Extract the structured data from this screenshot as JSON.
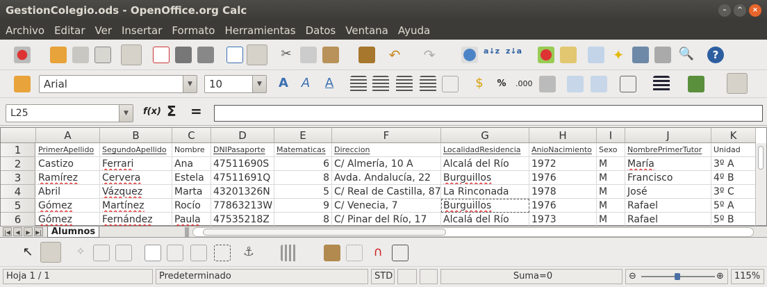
{
  "window": {
    "title": "GestionColegio.ods - OpenOffice.org Calc"
  },
  "menu": [
    "Archivo",
    "Editar",
    "Ver",
    "Insertar",
    "Formato",
    "Herramientas",
    "Datos",
    "Ventana",
    "Ayuda"
  ],
  "format_bar": {
    "font_name": "Arial",
    "font_size": "10"
  },
  "formula_bar": {
    "cell_ref": "L25",
    "fx": "f(x)",
    "sum": "Σ",
    "equals": "=",
    "content": ""
  },
  "columns": [
    "A",
    "B",
    "C",
    "D",
    "E",
    "F",
    "G",
    "H",
    "I",
    "J",
    "K"
  ],
  "rows": [
    "1",
    "2",
    "3",
    "4",
    "5",
    "6"
  ],
  "headers": [
    "PrimerApellido",
    "SegundoApellido",
    "Nombre",
    "DNIPasaporte",
    "Matematicas",
    "Direccion",
    "LocalidadResidencia",
    "AnioNacimiento",
    "Sexo",
    "NombrePrimerTutor",
    "Unidad"
  ],
  "data": [
    {
      "A": "Castizo",
      "B": "Ferrari",
      "C": "Ana",
      "D": "47511690S",
      "E": "6",
      "F": "C/ Almería, 10 A",
      "G": "Alcalá del Río",
      "H": "1972",
      "I": "M",
      "J": "María",
      "K": "3º A"
    },
    {
      "A": "Ramírez",
      "B": "Cervera",
      "C": "Estela",
      "D": "47511691Q",
      "E": "8",
      "F": "Avda. Andalucía, 22",
      "G": "Burguillos",
      "H": "1976",
      "I": "M",
      "J": "Francisco",
      "K": "4º B"
    },
    {
      "A": "Abril",
      "B": "Vázquez",
      "C": "Marta",
      "D": "43201326N",
      "E": "5",
      "F": "C/ Real de Castilla, 87",
      "G": "La Rinconada",
      "H": "1978",
      "I": "M",
      "J": "José",
      "K": "3º C"
    },
    {
      "A": "Gómez",
      "B": "Martínez",
      "C": "Rocío",
      "D": "77863213W",
      "E": "9",
      "F": "C/ Venecia, 7",
      "G": "Burguillos",
      "H": "1976",
      "I": "M",
      "J": "Rafael",
      "K": "5º A"
    },
    {
      "A": "Gómez",
      "B": "Fernández",
      "C": "Paula",
      "D": "47535218Z",
      "E": "8",
      "F": "C/ Pinar del Río, 17",
      "G": "Alcalá del Río",
      "H": "1973",
      "I": "M",
      "J": "Rafael",
      "K": "5º B"
    }
  ],
  "sheet_tab": "Alumnos",
  "status": {
    "sheet": "Hoja 1 / 1",
    "style": "Predeterminado",
    "mode": "STD",
    "sum": "Suma=0",
    "zoom": "115%"
  },
  "colors": {
    "titlebar": "#3c3b37",
    "close": "#e7652b",
    "squiggle": "#d33"
  }
}
